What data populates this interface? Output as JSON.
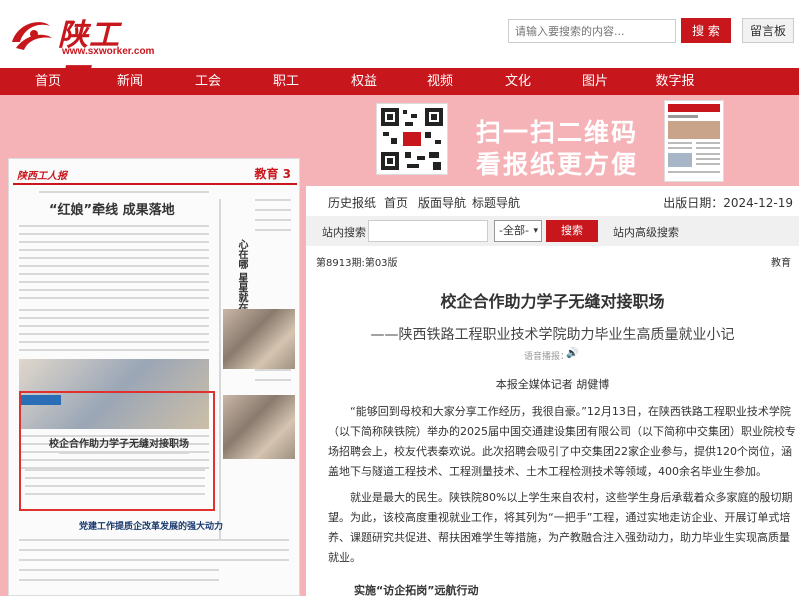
{
  "header": {
    "logo_text": "陕工网",
    "logo_url": "www.sxworker.com",
    "search_placeholder": "请输入要搜索的内容...",
    "search_button": "搜 索",
    "message_button": "留言板"
  },
  "nav": {
    "items": [
      "首页",
      "新闻",
      "工会",
      "职工",
      "权益",
      "视频",
      "文化",
      "图片",
      "数字报"
    ]
  },
  "banner": {
    "line1": "扫一扫二维码",
    "line2": "看报纸更方便"
  },
  "paper": {
    "logo": "陕西工人报",
    "section": "教育 3",
    "headline1": "“红娘”牵线  成果落地",
    "headline2": "校企合作助力学子无缝对接职场",
    "headline3": "党建工作提质企改革发展的强大动力",
    "side_text": "心在哪 星星就在哪"
  },
  "content": {
    "subnav": [
      "历史报纸",
      "首页",
      "版面导航",
      "标题导航"
    ],
    "date": "出版日期：2024-12-19",
    "search_label": "站内搜索",
    "search_select": "-全部-",
    "search_button": "搜索",
    "advanced_search": "站内高级搜索",
    "edition": "第8913期:第03版",
    "edition_section": "教育",
    "title": "校企合作助力学子无缝对接职场",
    "subtitle": "——陕西铁路工程职业技术学院助力毕业生高质量就业小记",
    "voice_label": "语音播报：",
    "author": "本报全媒体记者  胡健博",
    "para1": "“能够回到母校和大家分享工作经历，我很自豪。”12月13日，在陕西铁路工程职业技术学院（以下简称陕铁院）举办的2025届中国交通建设集团有限公司（以下简称中交集团）职业院校专场招聘会上，校友代表秦欢说。此次招聘会吸引了中交集团22家企业参与，提供120个岗位，涵盖地下与隧道工程技术、工程测量技术、土木工程检测技术等领域，400余名毕业生参加。",
    "para2": "就业是最大的民生。陕铁院80%以上学生来自农村，这些学生身后承载着众多家庭的殷切期望。为此，该校高度重视就业工作，将其列为“一把手”工程，通过实地走访企业、开展订单式培养、课题研究共促进、帮扶困难学生等措施，为产教融合注入强劲动力，助力毕业生实现高质量就业。",
    "subhead": "实施“访企拓岗”远航行动"
  }
}
